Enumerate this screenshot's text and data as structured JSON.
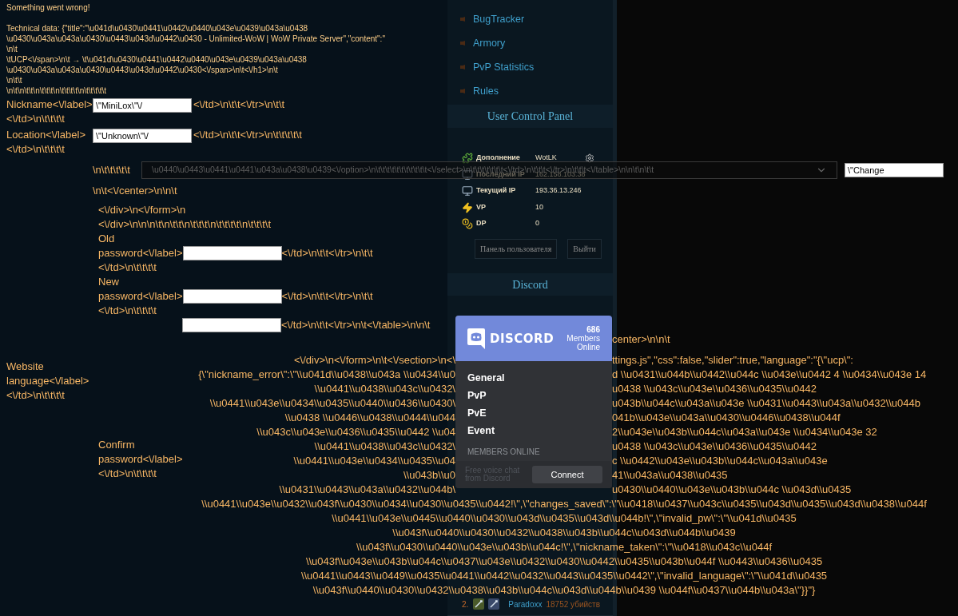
{
  "error": {
    "heading": "Something went wrong!",
    "technical_lines": [
      "Technical data: {\"title\":\"\\u041d\\u0430\\u0441\\u0442\\u0440\\u043e\\u0439\\u043a\\u0438",
      "\\u0430\\u043a\\u043a\\u0430\\u0443\\u043d\\u0442\\u0430 - Unlimited-WoW | WoW Private Server\",\"content\":\"",
      "\\n\\t",
      "\\tUCP<\\/span>\\n\\t → \\t\\u041d\\u0430\\u0441\\u0442\\u0440\\u043e\\u0439\\u043a\\u0438",
      "\\u0430\\u043a\\u043a\\u0430\\u0443\\u043d\\u0442\\u0430<\\/span>\\n\\t<\\/h1>\\n\\t",
      "\\n\\t\\t",
      "\\n\\t\\n\\t\\t\\n\\t\\t\\t\\n\\t\\t\\t\\t\\n\\t\\t\\t\\t\\t"
    ]
  },
  "form": {
    "fields": [
      {
        "label_lines": [
          "Nickname<\\/label>",
          "<\\/td>\\n\\t\\t\\t\\t"
        ],
        "value": "\\\"MiniLox\\\"\\/",
        "after": "<\\/td>\\n\\t\\t<\\/tr>\\n\\t\\t"
      },
      {
        "label_lines": [
          "Location<\\/label>",
          "<\\/td>\\n\\t\\t\\t\\t"
        ],
        "value": "\\\"Unknown\\\"\\/",
        "after": "<\\/td>\\n\\t\\t<\\/tr>\\n\\t\\t\\t\\t\\t"
      }
    ],
    "language_row": {
      "before": "\\n\\t\\t\\t\\t\\t",
      "select_value": "\\u0440\\u0443\\u0441\\u0441\\u043a\\u0438\\u0439<\\/option>\\n\\t\\t\\t\\t\\t\\t\\t\\t\\t\\t\\t<\\/select>\\n\\t\\t\\t\\t\\t\\t\\t<\\/td>\\n\\t\\t\\t<\\/tr>\\n\\t\\t\\t<\\/table>\\n\\n\\t\\n\\t\\t",
      "submit_value": "\\\"Change"
    },
    "after_select": "\\n\\t<\\/center>\\n\\n\\t",
    "closing_lines": [
      "<\\/div>\\n<\\/form>\\n",
      "<\\/div>\\n\\n\\n\\t\\n\\t\\t\\n\\t\\t\\t\\n\\t\\t\\t\\t\\n\\t\\t\\t\\t"
    ],
    "passwords": [
      {
        "label_lines": [
          "Old",
          "password<\\/label>",
          "<\\/td>\\n\\t\\t\\t\\t"
        ],
        "after": "<\\/td>\\n\\t\\t<\\/tr>\\n\\t\\t"
      },
      {
        "label_lines": [
          "New",
          "password<\\/label>",
          "<\\/td>\\n\\t\\t\\t\\t"
        ],
        "after": "<\\/td>\\n\\t\\t<\\/tr>\\n\\t\\t"
      }
    ],
    "confirm_after": "<\\/td>\\n\\t\\t<\\/tr>\\n\\t<\\/table>\\n\\n\\t",
    "language_label": [
      "Website",
      "language<\\/label>",
      "<\\/td>\\n\\t\\t\\t\\t"
    ],
    "confirm_label": [
      "Confirm",
      "password<\\/label>",
      "<\\/td>\\n\\t\\t\\t\\t"
    ]
  },
  "dump": {
    "split_lines": [
      {
        "right": "center>\\n\\n\\t"
      },
      {
        "left": "<\\/div>\\n<\\/form>\\n\\t<\\/section>\\n<\\",
        "right": "ttings.js\",\"css\":false,\"slider\":true,\"language\":\"{\\\"ucp\\\":"
      },
      {
        "left": "{\\\"nickname_error\\\":\\\"\\\\u041d\\\\u0438\\\\u043a \\\\u0434\\\\u0",
        "right": "d \\\\u0431\\\\u044b\\\\u0442\\\\u044c \\\\u043e\\\\u0442 4 \\\\u0434\\\\u043e 14"
      },
      {
        "left": "\\\\u0441\\\\u0438\\\\u043c\\\\u0432\\",
        "right": "u0438 \\\\u043c\\\\u043e\\\\u0436\\\\u0435\\\\u0442"
      },
      {
        "left": "\\\\u0441\\\\u043e\\\\u0434\\\\u0435\\\\u0440\\\\u0436\\\\u0430\\",
        "right": "u043b\\\\u044c\\\\u043a\\\\u043e \\\\u0431\\\\u0443\\\\u043a\\\\u0432\\\\u044b"
      },
      {
        "left": "\\\\u0438 \\\\u0446\\\\u0438\\\\u0444\\\\u044",
        "right": "041b\\\\u043e\\\\u043a\\\\u0430\\\\u0446\\\\u0438\\\\u044f"
      },
      {
        "left": "\\\\u043c\\\\u043e\\\\u0436\\\\u0435\\\\u0442 \\\\u04",
        "right": "2\\\\u043e\\\\u043b\\\\u044c\\\\u043a\\\\u043e \\\\u0434\\\\u043e 32"
      },
      {
        "left": "\\\\u0441\\\\u0438\\\\u043c\\\\u0432\\",
        "right": "u0438 \\\\u043c\\\\u043e\\\\u0436\\\\u0435\\\\u0442"
      },
      {
        "left": "\\\\u0441\\\\u043e\\\\u0434\\\\u0435\\\\u04",
        "right": "c \\\\u0442\\\\u043e\\\\u043b\\\\u044c\\\\u043a\\\\u043e"
      },
      {
        "left": "\\\\u043b\\\\u0",
        "right": "41\\\\u043a\\\\u0438\\\\u0435"
      },
      {
        "left": "\\\\u0431\\\\u0443\\\\u043a\\\\u0432\\\\u044b\\",
        "right": "u0430\\\\u0440\\\\u043e\\\\u043b\\\\u044c \\\\u043d\\\\u0435"
      }
    ],
    "full_lines": [
      "\\\\u0441\\\\u043e\\\\u0432\\\\u043f\\\\u0430\\\\u0434\\\\u0430\\\\u0435\\\\u0442!\\\",\\\"changes_saved\\\":\\\"\\\\u0418\\\\u0437\\\\u043c\\\\u0435\\\\u043d\\\\u0435\\\\u043d\\\\u0438\\\\u044f",
      "\\\\u0441\\\\u043e\\\\u0445\\\\u0440\\\\u0430\\\\u043d\\\\u0435\\\\u043d\\\\u044b!\\\",\\\"invalid_pw\\\":\\\"\\\\u041d\\\\u0435",
      "\\\\u043f\\\\u0440\\\\u0430\\\\u0432\\\\u0438\\\\u043b\\\\u044c\\\\u043d\\\\u044b\\\\u0439",
      "\\\\u043f\\\\u0430\\\\u0440\\\\u043e\\\\u043b\\\\u044c!\\\",\\\"nickname_taken\\\":\\\"\\\\u0418\\\\u043c\\\\u044f",
      "\\\\u043f\\\\u043e\\\\u043b\\\\u044c\\\\u0437\\\\u043e\\\\u0432\\\\u0430\\\\u0442\\\\u0435\\\\u043b\\\\u044f \\\\u0443\\\\u0436\\\\u0435",
      "\\\\u0441\\\\u0443\\\\u0449\\\\u0435\\\\u0441\\\\u0442\\\\u0432\\\\u0443\\\\u0435\\\\u0442\\\",\\\"invalid_language\\\":\\\"\\\\u041d\\\\u0435",
      "\\\\u043f\\\\u0440\\\\u0430\\\\u0432\\\\u0438\\\\u043b\\\\u044c\\\\u043d\\\\u044b\\\\u0439 \\\\u044f\\\\u0437\\\\u044b\\\\u043a\\\"}}\"}"
    ]
  },
  "sidebar": {
    "nav": [
      "BugTracker",
      "Armory",
      "PvP Statistics",
      "Rules"
    ],
    "ucp_title": "User Control Panel",
    "account": [
      {
        "kind": "addon",
        "label": "Дополнение",
        "value": "WotLK"
      },
      {
        "kind": "last_ip",
        "label": "Последний IP",
        "value": "162.158.103.38"
      },
      {
        "kind": "current_ip",
        "label": "Текущий IP",
        "value": "193.36.13.246"
      },
      {
        "kind": "vp",
        "label": "VP",
        "value": "10"
      },
      {
        "kind": "dp",
        "label": "DP",
        "value": "0"
      }
    ],
    "buttons": [
      "Панель пользователя",
      "Выйти"
    ],
    "discord_title": "Discord",
    "discord_widget": {
      "brand": "DISCORD",
      "members_count": "686",
      "members_label": "Members Online",
      "channels": [
        "General",
        "PvP",
        "PvE",
        "Event"
      ],
      "members_heading": "MEMBERS ONLINE",
      "footer": "Free voice chat from Discord",
      "connect": "Connect"
    },
    "ranking": [
      {
        "rank": "2.",
        "name": "Paradoxx",
        "kills": "18752 убийств"
      }
    ]
  }
}
